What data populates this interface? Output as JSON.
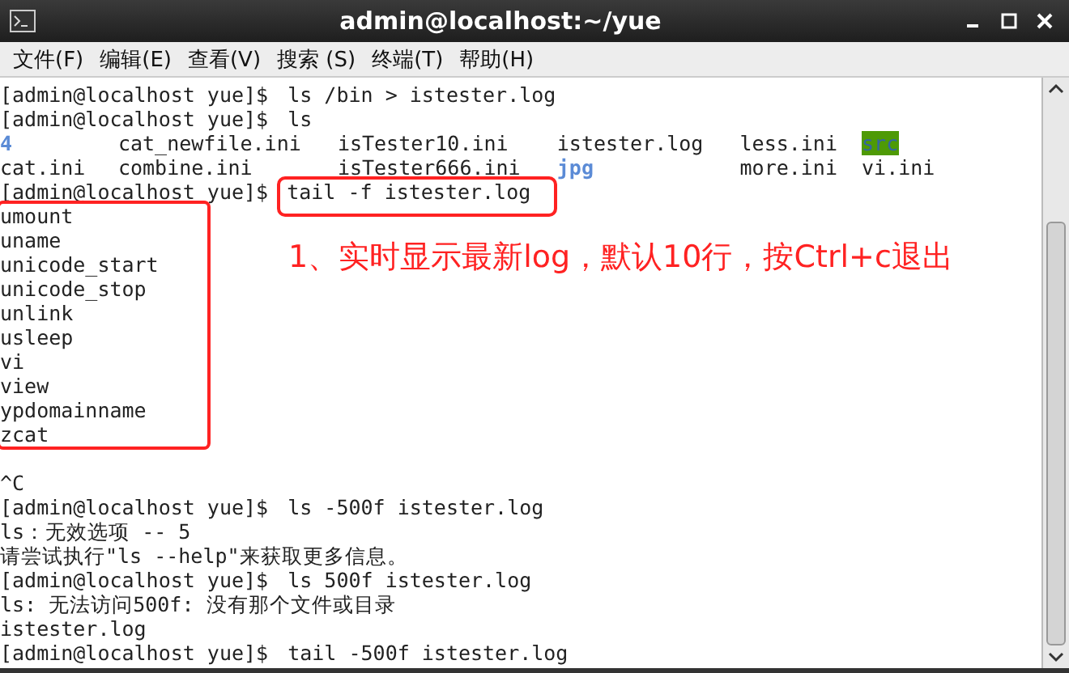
{
  "window": {
    "title": "admin@localhost:~/yue"
  },
  "menu": [
    "文件(F)",
    "编辑(E)",
    "查看(V)",
    "搜索 (S)",
    "终端(T)",
    "帮助(H)"
  ],
  "terminal": {
    "lines": [
      {
        "kind": "prompt",
        "prompt": "[admin@localhost yue]$",
        "command": "ls /bin > istester.log",
        "boxed": false
      },
      {
        "kind": "prompt",
        "prompt": "[admin@localhost yue]$",
        "command": "ls",
        "boxed": false
      },
      {
        "kind": "listing",
        "cells": [
          {
            "text": "4",
            "kind": "dir"
          },
          {
            "text": "cat_newfile.ini",
            "kind": "file"
          },
          {
            "text": "isTester10.ini",
            "kind": "file"
          },
          {
            "text": "istester.log",
            "kind": "file"
          },
          {
            "text": "less.ini",
            "kind": "file"
          },
          {
            "text": "src",
            "kind": "writable"
          }
        ]
      },
      {
        "kind": "listing",
        "cells": [
          {
            "text": "cat.ini",
            "kind": "file"
          },
          {
            "text": "combine.ini",
            "kind": "file"
          },
          {
            "text": "isTester666.ini",
            "kind": "file"
          },
          {
            "text": "jpg",
            "kind": "dir"
          },
          {
            "text": "more.ini",
            "kind": "file"
          },
          {
            "text": "vi.ini",
            "kind": "file"
          }
        ]
      },
      {
        "kind": "prompt",
        "prompt": "[admin@localhost yue]$",
        "command": "tail -f istester.log",
        "boxed": true
      },
      {
        "kind": "group",
        "boxed": true,
        "note": "1、实时显示最新log，默认10行，按Ctrl+c退出",
        "lines": [
          "umount",
          "uname",
          "unicode_start",
          "unicode_stop",
          "unlink",
          "usleep",
          "vi",
          "view",
          "ypdomainname",
          "zcat"
        ]
      },
      {
        "kind": "blank"
      },
      {
        "kind": "output",
        "text": "^C"
      },
      {
        "kind": "prompt",
        "prompt": "[admin@localhost yue]$",
        "command": "ls -500f istester.log",
        "boxed": false
      },
      {
        "kind": "output",
        "text": "ls：无效选项 -- 5"
      },
      {
        "kind": "output",
        "text": "请尝试执行\"ls --help\"来获取更多信息。"
      },
      {
        "kind": "prompt",
        "prompt": "[admin@localhost yue]$",
        "command": "ls 500f istester.log",
        "boxed": false
      },
      {
        "kind": "output",
        "text": "ls: 无法访问500f: 没有那个文件或目录"
      },
      {
        "kind": "output",
        "text": "istester.log"
      },
      {
        "kind": "prompt",
        "prompt": "[admin@localhost yue]$",
        "command": "tail -500f istester.log",
        "boxed": false
      }
    ]
  }
}
